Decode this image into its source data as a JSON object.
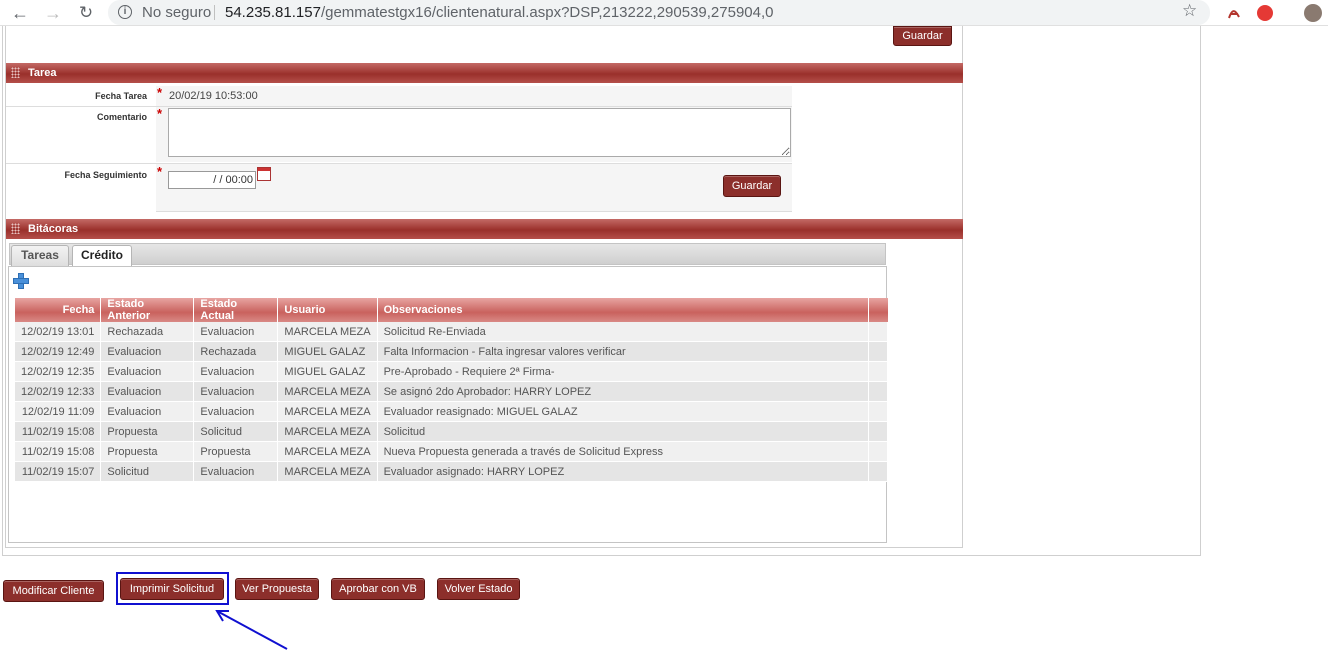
{
  "browser": {
    "security_label": "No seguro",
    "url_host": "54.235.81.157",
    "url_path": "/gemmatestgx16/clientenatural.aspx?DSP,213222,290539,275904,0",
    "back_icon": "arrow-left-icon",
    "forward_icon": "arrow-right-icon",
    "reload_icon": "reload-icon",
    "star_icon": "star-icon"
  },
  "top": {
    "save_label": "Guardar"
  },
  "tarea": {
    "title": "Tarea",
    "fecha_label": "Fecha Tarea",
    "fecha_value": "20/02/19 10:53:00",
    "comentario_label": "Comentario",
    "comentario_value": "",
    "seguimiento_label": "Fecha Seguimiento",
    "seguimiento_value": "/ /  00:00",
    "required_mark": "*",
    "save_label": "Guardar"
  },
  "bitacoras": {
    "title": "Bitácoras",
    "tabs": [
      {
        "label": "Tareas",
        "active": false
      },
      {
        "label": "Crédito",
        "active": true
      }
    ],
    "columns": [
      "Fecha",
      "Estado Anterior",
      "Estado Actual",
      "Usuario",
      "Observaciones"
    ],
    "rows": [
      [
        "12/02/19 13:01",
        "Rechazada",
        "Evaluacion",
        "MARCELA MEZA",
        "Solicitud Re-Enviada"
      ],
      [
        "12/02/19 12:49",
        "Evaluacion",
        "Rechazada",
        "MIGUEL GALAZ",
        "Falta Informacion - Falta ingresar valores verificar"
      ],
      [
        "12/02/19 12:35",
        "Evaluacion",
        "Evaluacion",
        "MIGUEL GALAZ",
        "Pre-Aprobado - Requiere 2ª Firma-"
      ],
      [
        "12/02/19 12:33",
        "Evaluacion",
        "Evaluacion",
        "MARCELA MEZA",
        "Se asignó 2do Aprobador: HARRY LOPEZ"
      ],
      [
        "12/02/19 11:09",
        "Evaluacion",
        "Evaluacion",
        "MARCELA MEZA",
        "Evaluador reasignado: MIGUEL GALAZ"
      ],
      [
        "11/02/19 15:08",
        "Propuesta",
        "Solicitud",
        "MARCELA MEZA",
        "Solicitud"
      ],
      [
        "11/02/19 15:08",
        "Propuesta",
        "Propuesta",
        "MARCELA MEZA",
        "Nueva Propuesta generada a través de Solicitud Express"
      ],
      [
        "11/02/19 15:07",
        "Solicitud",
        "Evaluacion",
        "MARCELA MEZA",
        "Evaluador asignado: HARRY LOPEZ"
      ]
    ]
  },
  "actions": {
    "modificar": "Modificar Cliente",
    "imprimir": "Imprimir Solicitud",
    "ver": "Ver Propuesta",
    "aprobar": "Aprobar con VB",
    "volver": "Volver Estado"
  },
  "colors": {
    "accent": "#8c2f2b",
    "header_red": "#9a302b",
    "highlight": "#1010d0"
  }
}
